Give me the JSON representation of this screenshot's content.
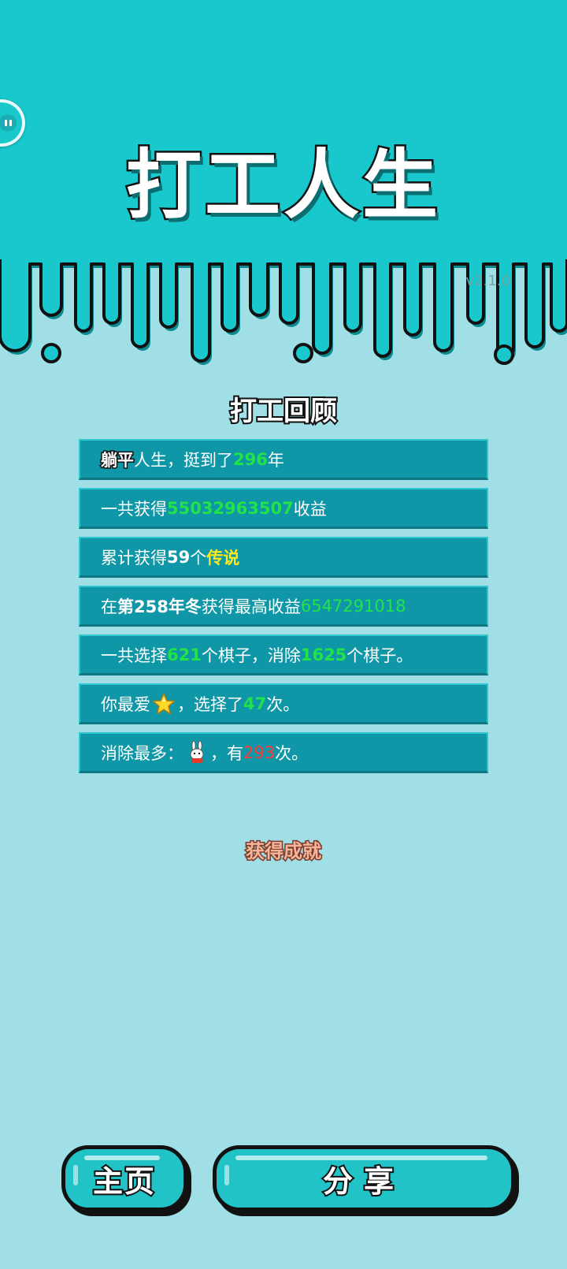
{
  "game": {
    "title": "打工人生",
    "version": "v2.1.0"
  },
  "review": {
    "title": "打工回顾",
    "rows": [
      {
        "parts": [
          {
            "text": "躺平",
            "style": "outline-white"
          },
          {
            "text": "人生，挺到了",
            "style": "plain"
          },
          {
            "text": "296",
            "style": "green"
          },
          {
            "text": "年",
            "style": "plain"
          }
        ]
      },
      {
        "parts": [
          {
            "text": "一共获得",
            "style": "plain"
          },
          {
            "text": "55032963507",
            "style": "green"
          },
          {
            "text": "收益",
            "style": "plain"
          }
        ]
      },
      {
        "parts": [
          {
            "text": "累计获得",
            "style": "plain"
          },
          {
            "text": "59",
            "style": "b"
          },
          {
            "text": "个",
            "style": "plain"
          },
          {
            "text": "传说",
            "style": "yellow"
          }
        ]
      },
      {
        "parts": [
          {
            "text": "在 ",
            "style": "plain"
          },
          {
            "text": "第258年冬",
            "style": "b"
          },
          {
            "text": " 获得最高收益",
            "style": "plain"
          },
          {
            "text": "6547291018",
            "style": "green-thin"
          }
        ]
      },
      {
        "parts": [
          {
            "text": "一共选择",
            "style": "plain"
          },
          {
            "text": "621",
            "style": "green"
          },
          {
            "text": "个棋子，消除",
            "style": "plain"
          },
          {
            "text": "1625",
            "style": "green"
          },
          {
            "text": "个棋子。",
            "style": "plain"
          }
        ]
      },
      {
        "parts": [
          {
            "text": "你最爱",
            "style": "plain"
          },
          {
            "icon": "star-icon"
          },
          {
            "text": "，选择了",
            "style": "plain"
          },
          {
            "text": "47",
            "style": "green"
          },
          {
            "text": "次。",
            "style": "plain"
          }
        ]
      },
      {
        "parts": [
          {
            "text": "消除最多：",
            "style": "plain"
          },
          {
            "icon": "rabbit-icon"
          },
          {
            "text": "，有",
            "style": "plain"
          },
          {
            "text": "293",
            "style": "red"
          },
          {
            "text": "次。",
            "style": "plain"
          }
        ]
      }
    ]
  },
  "achievement_label": "获得成就",
  "buttons": {
    "home": "主页",
    "share": "分享"
  },
  "colors": {
    "top_teal": "#19c8cc",
    "page_bg": "#a0dfe5",
    "row_bg": "#1097a7",
    "accent_green": "#22e24a",
    "accent_yellow": "#ffe81a",
    "accent_red": "#ff3a3a"
  }
}
